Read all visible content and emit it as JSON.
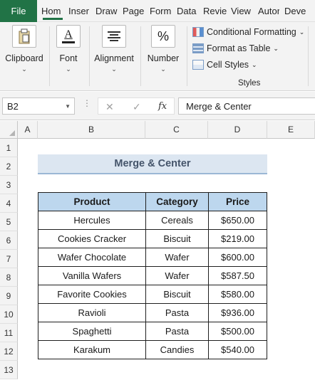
{
  "tabs": [
    {
      "label": "File"
    },
    {
      "label": "Hom"
    },
    {
      "label": "Inser"
    },
    {
      "label": "Draw"
    },
    {
      "label": "Page"
    },
    {
      "label": "Form"
    },
    {
      "label": "Data"
    },
    {
      "label": "Revie"
    },
    {
      "label": "View"
    },
    {
      "label": "Autor"
    },
    {
      "label": "Deve"
    }
  ],
  "ribbon": {
    "clipboard": "Clipboard",
    "font": "Font",
    "alignment": "Alignment",
    "number": "Number",
    "number_glyph": "%",
    "font_glyph": "A",
    "chevron": "⌄",
    "conditional_formatting": "Conditional Formatting",
    "format_as_table": "Format as Table",
    "cell_styles": "Cell Styles",
    "styles_group": "Styles"
  },
  "formula_bar": {
    "name_box": "B2",
    "cancel": "✕",
    "enter": "✓",
    "fx": "fx",
    "content": "Merge & Center"
  },
  "sheet": {
    "columns": [
      "A",
      "B",
      "C",
      "D",
      "E"
    ],
    "rows": [
      "1",
      "2",
      "3",
      "4",
      "5",
      "6",
      "7",
      "8",
      "9",
      "10",
      "11",
      "12",
      "13"
    ],
    "title": "Merge & Center",
    "headers": [
      "Product",
      "Category",
      "Price"
    ],
    "data": [
      [
        "Hercules",
        "Cereals",
        "$650.00"
      ],
      [
        "Cookies Cracker",
        "Biscuit",
        "$219.00"
      ],
      [
        "Wafer Chocolate",
        "Wafer",
        "$600.00"
      ],
      [
        "Vanilla Wafers",
        "Wafer",
        "$587.50"
      ],
      [
        "Favorite Cookies",
        "Biscuit",
        "$580.00"
      ],
      [
        "Ravioli",
        "Pasta",
        "$936.00"
      ],
      [
        "Spaghetti",
        "Pasta",
        "$500.00"
      ],
      [
        "Karakum",
        "Candies",
        "$540.00"
      ]
    ]
  },
  "colors": {
    "excel_green": "#217346",
    "header_fill": "#bdd7ee",
    "title_fill": "#dce6f1"
  }
}
